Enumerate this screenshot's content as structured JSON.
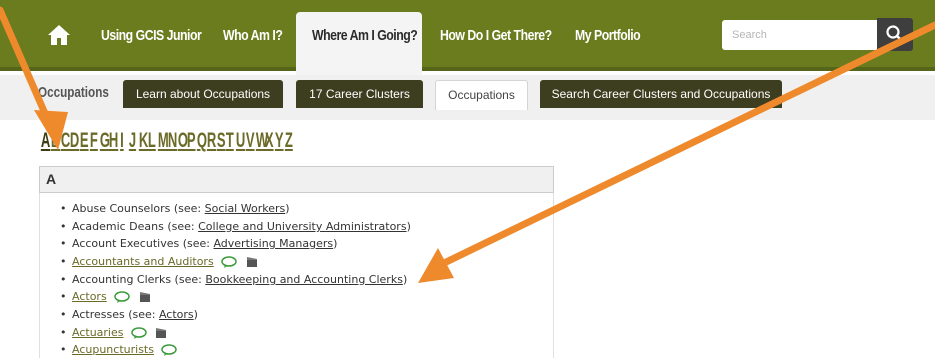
{
  "topnav": {
    "items": [
      {
        "label": "Using GCIS Junior"
      },
      {
        "label": "Who Am I?"
      },
      {
        "label": "Where Am I Going?"
      },
      {
        "label": "How Do I Get There?"
      },
      {
        "label": "My Portfolio"
      }
    ],
    "search_placeholder": "Search"
  },
  "subnav": {
    "section_label": "Occupations",
    "tabs": [
      {
        "label": "Learn about Occupations"
      },
      {
        "label": "17 Career Clusters"
      },
      {
        "label": "Occupations"
      },
      {
        "label": "Search Career Clusters and Occupations"
      }
    ]
  },
  "alphabet": [
    "A",
    "B",
    "C",
    "D",
    "E",
    "F",
    "G",
    "H",
    "I",
    "J",
    "K",
    "L",
    "M",
    "N",
    "O",
    "P",
    "Q",
    "R",
    "S",
    "T",
    "U",
    "V",
    "W",
    "X",
    "Y",
    "Z"
  ],
  "list": {
    "heading": "A",
    "items": [
      {
        "text": "Abuse Counselors (see: ",
        "link": "Social Workers",
        "suffix": ")"
      },
      {
        "text": "Academic Deans (see: ",
        "link": "College and University Administrators",
        "suffix": ")"
      },
      {
        "text": "Account Executives (see: ",
        "link": "Advertising Managers",
        "suffix": ")"
      },
      {
        "link": "Accountants and Auditors"
      },
      {
        "text": "Accounting Clerks (see: ",
        "link": "Bookkeeping and Accounting Clerks",
        "suffix": ")"
      },
      {
        "link": "Actors"
      },
      {
        "text": "Actresses (see: ",
        "link": "Actors",
        "suffix": ")"
      },
      {
        "link": "Actuaries"
      },
      {
        "link": "Acupuncturists"
      }
    ]
  },
  "colors": {
    "nav_green": "#6b7c1e",
    "tab_dark": "#3d3d20",
    "arrow_orange": "#ef8a2c",
    "link_olive": "#6b6a28"
  }
}
